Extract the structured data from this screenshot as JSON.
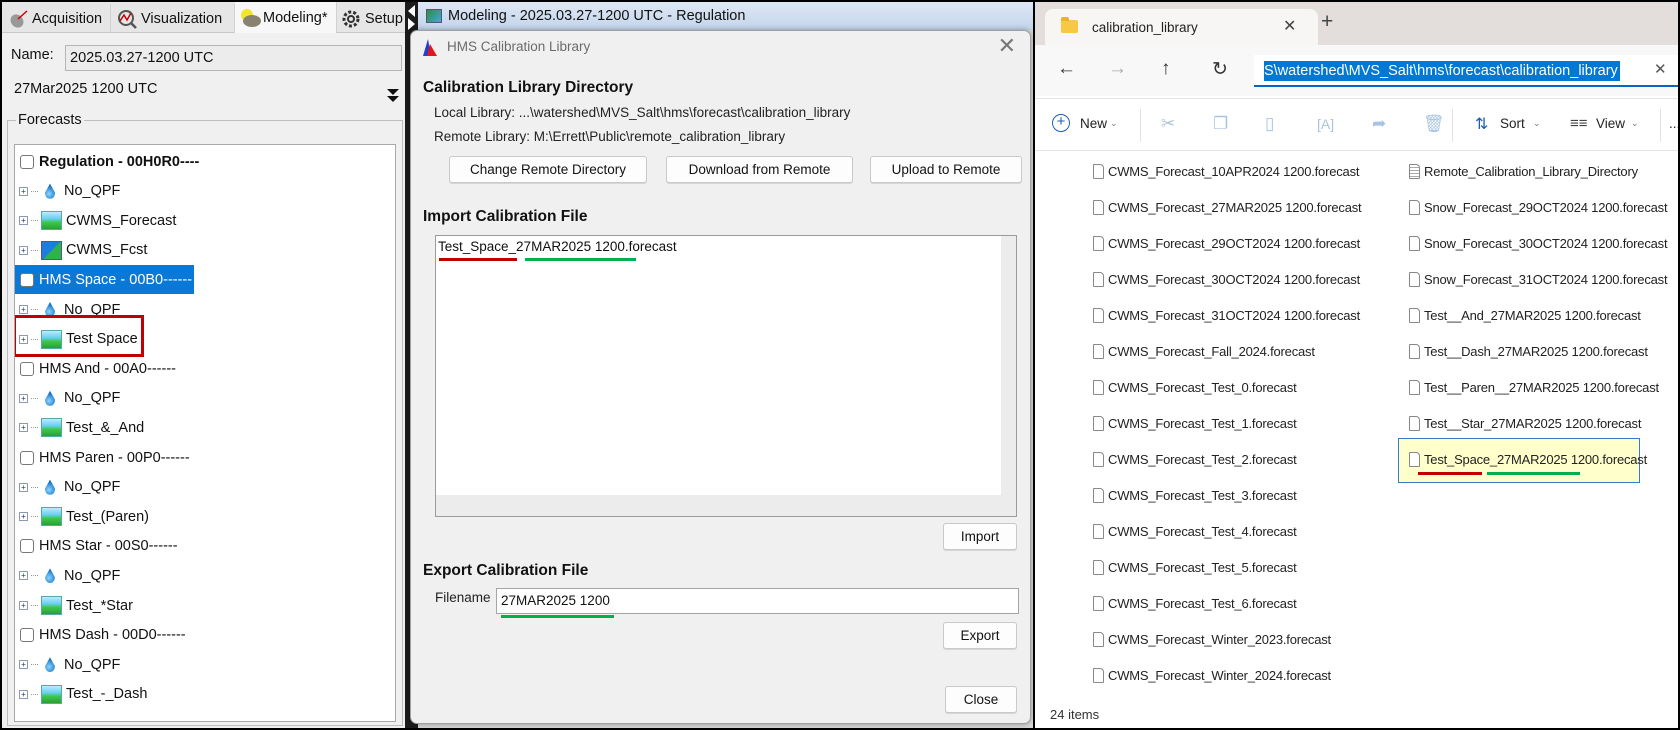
{
  "left_panel": {
    "tabs": [
      {
        "label": "Acquisition",
        "icon": "satellite-dish-icon",
        "selected": false
      },
      {
        "label": "Visualization",
        "icon": "chart-magnifier-icon",
        "selected": false
      },
      {
        "label": "Modeling*",
        "icon": "sun-cloud-icon",
        "selected": true
      },
      {
        "label": "Setup",
        "icon": "gear-icon",
        "selected": false
      }
    ],
    "name_label": "Name:",
    "name_value": "2025.03.27-1200 UTC",
    "date_text": "27Mar2025 1200 UTC",
    "forecasts_title": "Forecasts",
    "tree": [
      {
        "label": "Regulation - 00H0R0----",
        "kind": "group",
        "bold": true
      },
      {
        "label": "No_QPF",
        "kind": "child",
        "icon": "water-drop-icon"
      },
      {
        "label": "CWMS_Forecast",
        "kind": "child",
        "icon": "landscape-icon"
      },
      {
        "label": "CWMS_Fcst",
        "kind": "child",
        "icon": "dam-icon"
      },
      {
        "label": "HMS Space - 00B0------",
        "kind": "group",
        "selected": true
      },
      {
        "label": "No_QPF",
        "kind": "child",
        "icon": "water-drop-icon"
      },
      {
        "label": "Test Space",
        "kind": "child",
        "icon": "landscape-icon",
        "highlighted": true
      },
      {
        "label": "HMS And - 00A0------",
        "kind": "group"
      },
      {
        "label": "No_QPF",
        "kind": "child",
        "icon": "water-drop-icon"
      },
      {
        "label": "Test_&_And",
        "kind": "child",
        "icon": "landscape-icon"
      },
      {
        "label": "HMS Paren - 00P0------",
        "kind": "group"
      },
      {
        "label": "No_QPF",
        "kind": "child",
        "icon": "water-drop-icon"
      },
      {
        "label": "Test_(Paren)",
        "kind": "child",
        "icon": "landscape-icon"
      },
      {
        "label": "HMS Star - 00S0------",
        "kind": "group"
      },
      {
        "label": "No_QPF",
        "kind": "child",
        "icon": "water-drop-icon"
      },
      {
        "label": "Test_*Star",
        "kind": "child",
        "icon": "landscape-icon"
      },
      {
        "label": "HMS Dash - 00D0------",
        "kind": "group"
      },
      {
        "label": "No_QPF",
        "kind": "child",
        "icon": "water-drop-icon"
      },
      {
        "label": "Test_-_Dash",
        "kind": "child",
        "icon": "landscape-icon"
      }
    ]
  },
  "modeling_window": {
    "title": "Modeling - 2025.03.27-1200 UTC - Regulation"
  },
  "dialog": {
    "title": "HMS Calibration Library",
    "directory_heading": "Calibration Library Directory",
    "local_library": "Local Library: ...\\watershed\\MVS_Salt\\hms\\forecast\\calibration_library",
    "remote_library": "Remote Library: M:\\Errett\\Public\\remote_calibration_library",
    "buttons": {
      "change_remote": "Change Remote Directory",
      "download": "Download from Remote",
      "upload": "Upload to Remote",
      "import": "Import",
      "export": "Export",
      "close": "Close"
    },
    "import_heading": "Import Calibration File",
    "import_files": [
      "Test_Space_27MAR2025 1200.forecast"
    ],
    "export_heading": "Export Calibration File",
    "filename_label": "Filename",
    "filename_value": "27MAR2025 1200"
  },
  "explorer": {
    "tab_title": "calibration_library",
    "new_tab": "+",
    "address": "S\\watershed\\MVS_Salt\\hms\\forecast\\calibration_library",
    "toolbar": {
      "new": "New",
      "sort": "Sort",
      "view": "View",
      "more": "..."
    },
    "columns": [
      [
        "CWMS_Forecast_10APR2024 1200.forecast",
        "CWMS_Forecast_27MAR2025 1200.forecast",
        "CWMS_Forecast_29OCT2024 1200.forecast",
        "CWMS_Forecast_30OCT2024 1200.forecast",
        "CWMS_Forecast_31OCT2024 1200.forecast",
        "CWMS_Forecast_Fall_2024.forecast",
        "CWMS_Forecast_Test_0.forecast",
        "CWMS_Forecast_Test_1.forecast",
        "CWMS_Forecast_Test_2.forecast",
        "CWMS_Forecast_Test_3.forecast",
        "CWMS_Forecast_Test_4.forecast",
        "CWMS_Forecast_Test_5.forecast",
        "CWMS_Forecast_Test_6.forecast",
        "CWMS_Forecast_Winter_2023.forecast",
        "CWMS_Forecast_Winter_2024.forecast"
      ],
      [
        "Remote_Calibration_Library_Directory",
        "Snow_Forecast_29OCT2024 1200.forecast",
        "Snow_Forecast_30OCT2024 1200.forecast",
        "Snow_Forecast_31OCT2024 1200.forecast",
        "Test__And_27MAR2025 1200.forecast",
        "Test__Dash_27MAR2025 1200.forecast",
        "Test__Paren__27MAR2025 1200.forecast",
        "Test__Star_27MAR2025 1200.forecast",
        "Test_Space_27MAR2025 1200.forecast"
      ]
    ],
    "selected_file": "Test_Space_27MAR2025 1200.forecast",
    "status": "24 items"
  },
  "colors": {
    "selection": "#0a78d7",
    "annotation_red": "#c00000",
    "annotation_green": "#00b050",
    "explorer_selected": "#ffffcc"
  }
}
